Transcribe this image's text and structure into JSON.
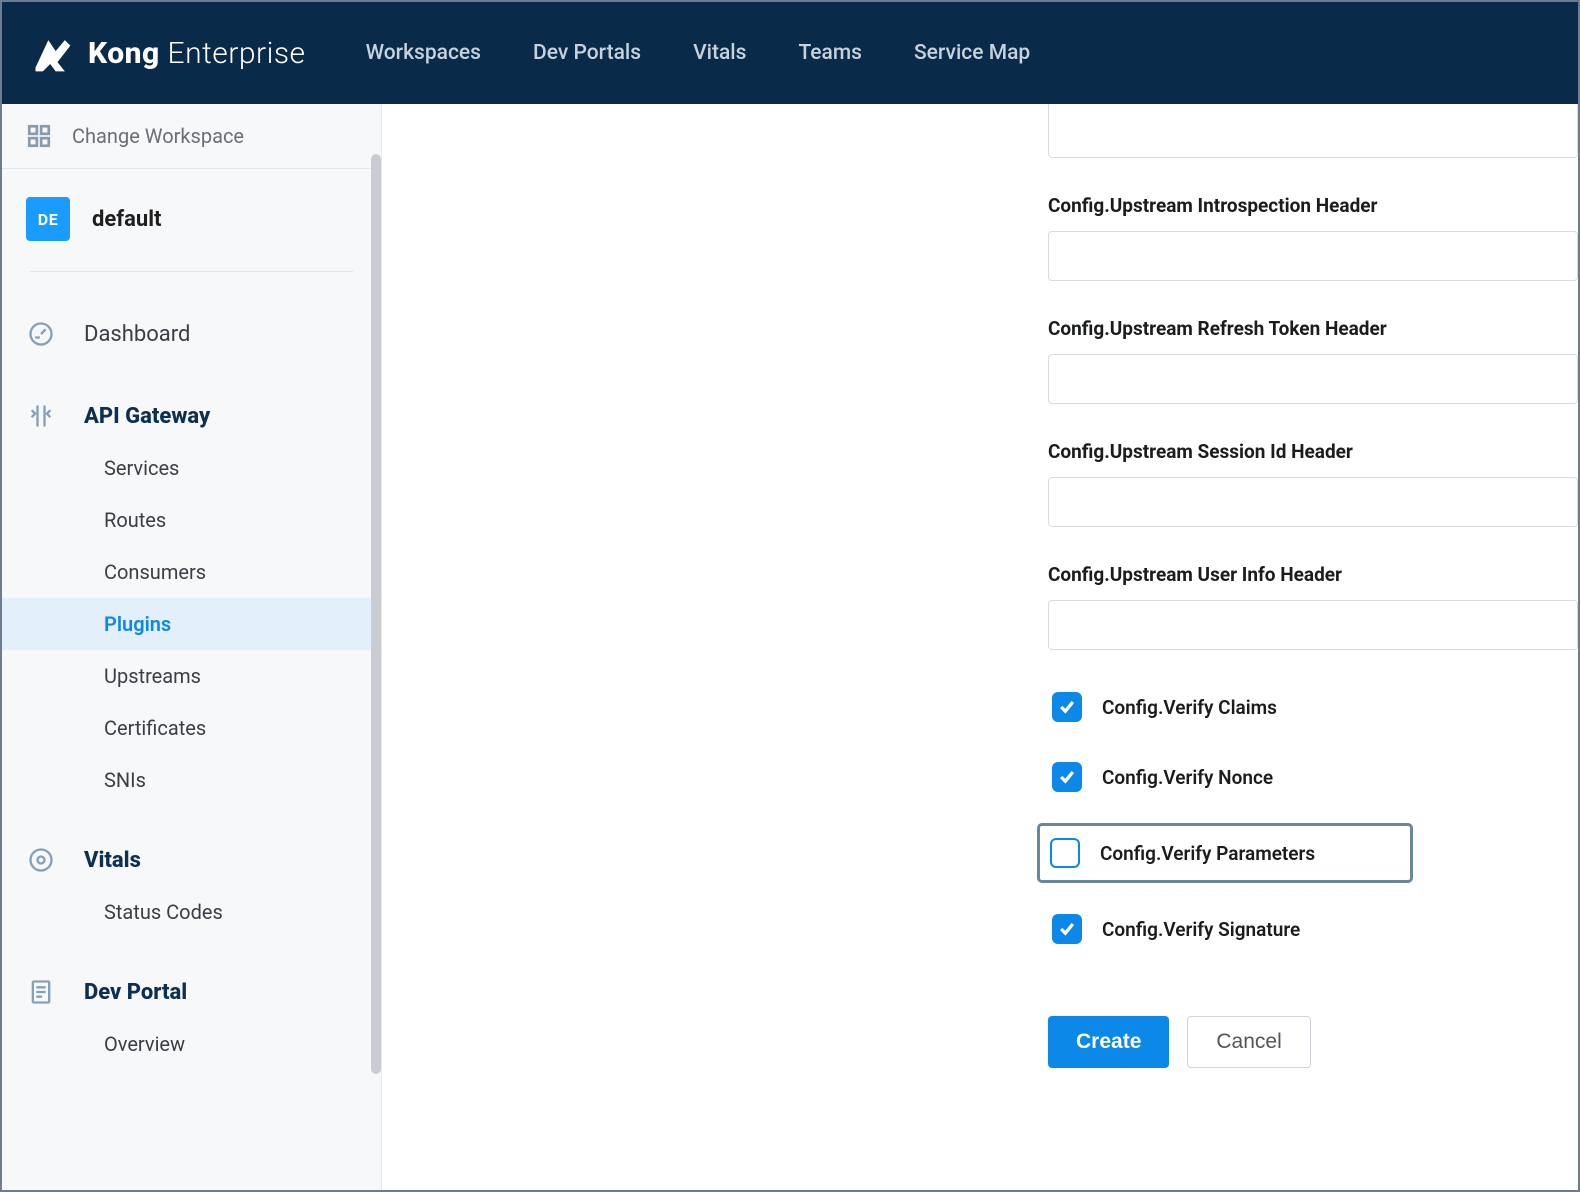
{
  "brand": {
    "name_strong": "Kong",
    "name_light": "Enterprise"
  },
  "topnav": {
    "links": [
      {
        "label": "Workspaces"
      },
      {
        "label": "Dev Portals"
      },
      {
        "label": "Vitals"
      },
      {
        "label": "Teams"
      },
      {
        "label": "Service Map"
      }
    ]
  },
  "sidebar": {
    "change_ws": "Change Workspace",
    "workspace_code": "DE",
    "workspace_name": "default",
    "dashboard": "Dashboard",
    "api_gateway": {
      "heading": "API Gateway",
      "items": [
        {
          "label": "Services"
        },
        {
          "label": "Routes"
        },
        {
          "label": "Consumers"
        },
        {
          "label": "Plugins",
          "active": true
        },
        {
          "label": "Upstreams"
        },
        {
          "label": "Certificates"
        },
        {
          "label": "SNIs"
        }
      ]
    },
    "vitals": {
      "heading": "Vitals",
      "items": [
        {
          "label": "Status Codes"
        }
      ]
    },
    "dev_portal": {
      "heading": "Dev Portal",
      "items": [
        {
          "label": "Overview"
        }
      ]
    }
  },
  "form": {
    "fields": [
      {
        "label": "Config.Upstream Introspection Header",
        "value": ""
      },
      {
        "label": "Config.Upstream Refresh Token Header",
        "value": ""
      },
      {
        "label": "Config.Upstream Session Id Header",
        "value": ""
      },
      {
        "label": "Config.Upstream User Info Header",
        "value": ""
      }
    ],
    "checkboxes": [
      {
        "label": "Config.Verify Claims",
        "checked": true
      },
      {
        "label": "Config.Verify Nonce",
        "checked": true
      },
      {
        "label": "Config.Verify Parameters",
        "checked": false,
        "highlight": true
      },
      {
        "label": "Config.Verify Signature",
        "checked": true
      }
    ],
    "actions": {
      "create": "Create",
      "cancel": "Cancel"
    }
  }
}
